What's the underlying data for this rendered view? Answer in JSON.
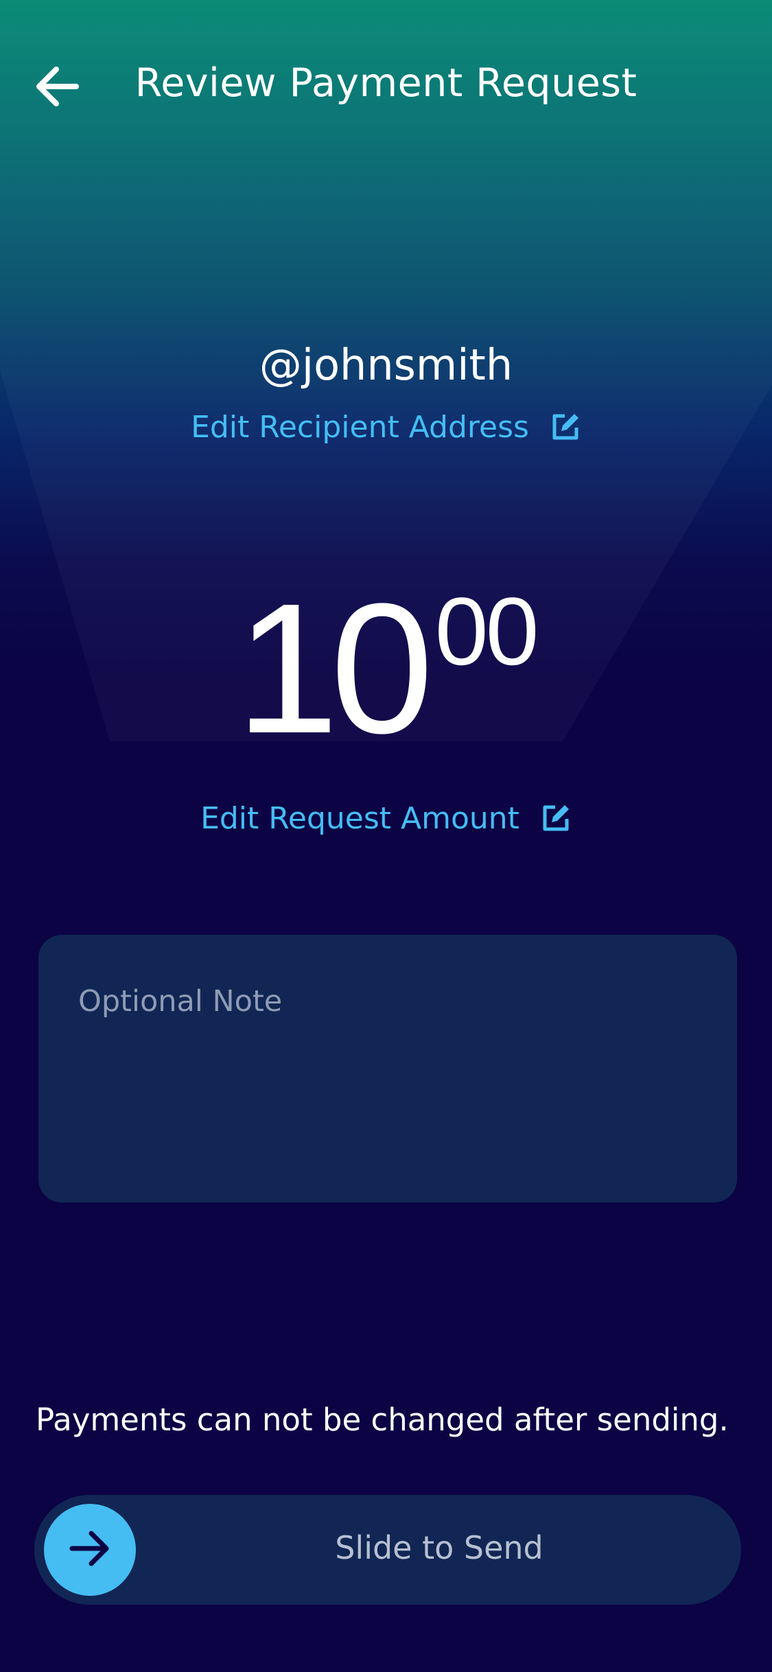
{
  "header": {
    "title": "Review Payment Request",
    "back_icon": "arrow-left-icon"
  },
  "recipient": {
    "handle": "@johnsmith",
    "edit_label": "Edit Recipient Address",
    "edit_icon": "edit-icon"
  },
  "amount": {
    "whole": "10",
    "cents": "00",
    "edit_label": "Edit Request Amount",
    "edit_icon": "edit-icon"
  },
  "note": {
    "placeholder": "Optional Note",
    "value": ""
  },
  "footer": {
    "warning": "Payments can not be changed after sending.",
    "slider_label": "Slide to Send",
    "slider_icon": "arrow-right-icon"
  },
  "colors": {
    "accent": "#45bdf3",
    "background": "#0b0344",
    "gradient_top": "#038873",
    "card": "#112654"
  }
}
